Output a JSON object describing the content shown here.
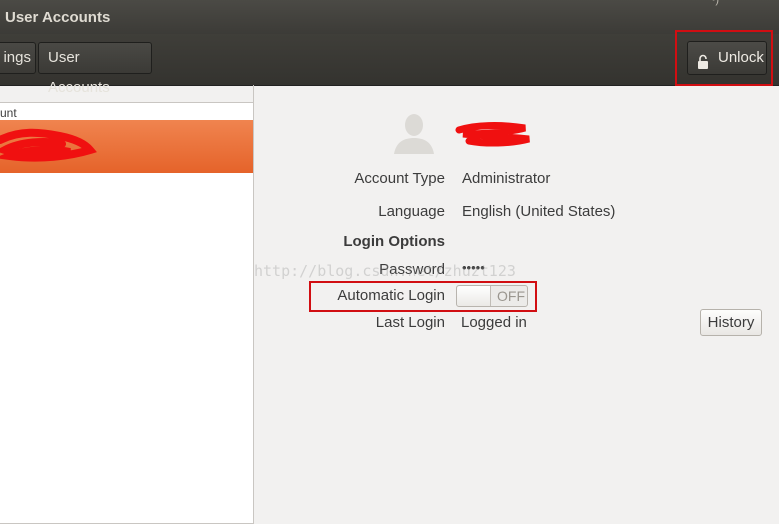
{
  "window": {
    "title": "User Accounts",
    "corner_glyph": "ᶜ)"
  },
  "toolbar": {
    "breadcrumbs": [
      {
        "label": "ings"
      },
      {
        "label": "User Accounts"
      }
    ],
    "unlock_label": "Unlock",
    "lock_icon": "padlock-icon"
  },
  "accounts_list": {
    "group_label": "unt",
    "selected_index": 0,
    "accent_color": "#e9682f"
  },
  "account": {
    "avatar_icon": "user-silhouette-icon",
    "fields": [
      {
        "label": "Account Type",
        "value": "Administrator"
      },
      {
        "label": "Language",
        "value": "English (United States)"
      }
    ],
    "login_options_heading": "Login Options",
    "password": {
      "label": "Password",
      "value": "•••••"
    },
    "automatic_login": {
      "label": "Automatic Login",
      "state": "OFF",
      "on": false
    },
    "last_login": {
      "label": "Last Login",
      "value": "Logged in"
    },
    "history_button": "History"
  },
  "watermark": "http://blog.csdn.net/zhuzt123",
  "highlight_color": "#d10e12"
}
